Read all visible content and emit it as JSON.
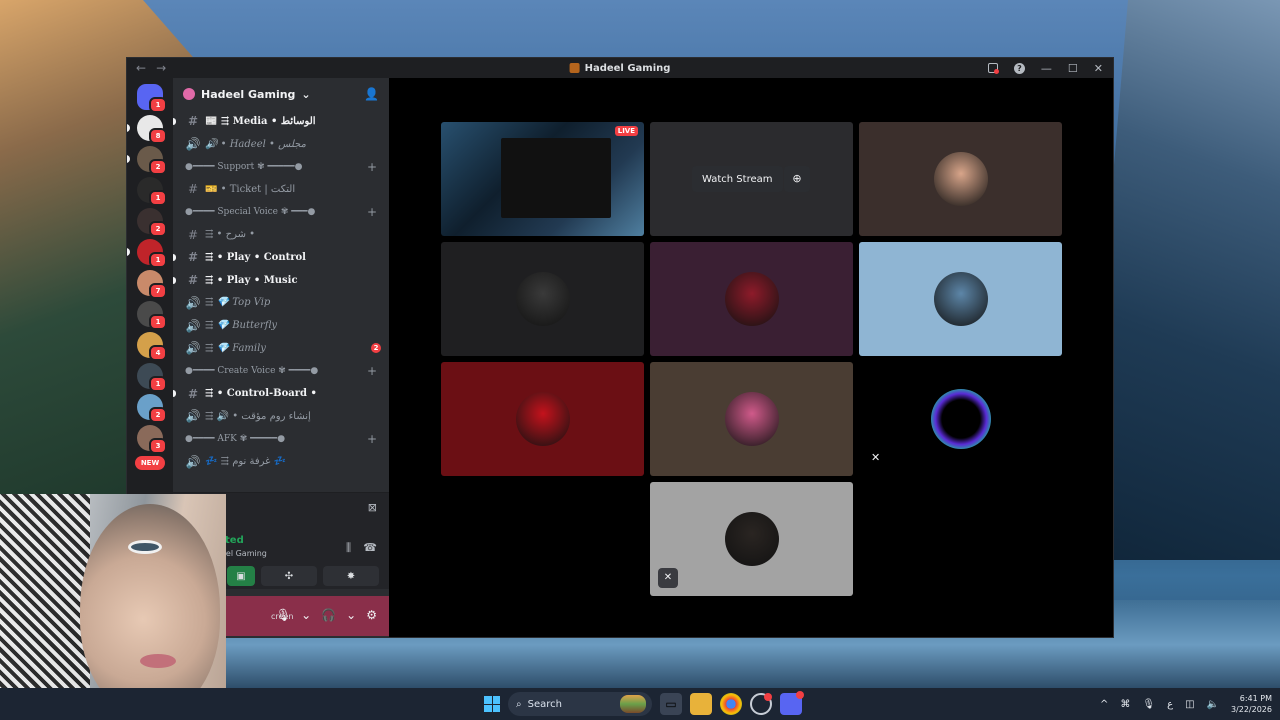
{
  "window": {
    "title": "Hadeel Gaming",
    "nav_back": "←",
    "nav_forward": "→",
    "help": "?",
    "minimize": "—",
    "maximize": "☐",
    "close": "✕"
  },
  "rail": {
    "servers": [
      {
        "badge": "1",
        "color": "#5865f2"
      },
      {
        "badge": "8",
        "color": "#e8e8e8"
      },
      {
        "badge": "2",
        "color": "#6a5a4a"
      },
      {
        "badge": "1",
        "color": "#2a2a2a"
      },
      {
        "badge": "2",
        "color": "#3a3030"
      },
      {
        "badge": "1",
        "color": "#c0242a"
      },
      {
        "badge": "7",
        "color": "#c98a6a"
      },
      {
        "badge": "1",
        "color": "#4a4a4a"
      },
      {
        "badge": "4",
        "color": "#d4a04a"
      },
      {
        "badge": "1",
        "color": "#3d4a55"
      },
      {
        "badge": "2",
        "color": "#6aa0c9"
      },
      {
        "badge": "3",
        "color": "#8a6a5a"
      }
    ],
    "new_label": "NEW"
  },
  "guild": {
    "name": "Hadeel Gaming",
    "chevron": "⌄"
  },
  "channels": [
    {
      "kind": "text",
      "icon": "#",
      "name": "📰 ⇶ Media • الوسائط",
      "bold": true,
      "italic": false
    },
    {
      "kind": "voice",
      "icon": "🔊",
      "name": "🔊 • Hadeel • مجلس",
      "bold": false,
      "italic": true
    },
    {
      "kind": "category",
      "name": "●━━━━ Support ✾ ━━━━━●"
    },
    {
      "kind": "text",
      "icon": "#",
      "name": "🎫 • Ticket | التكت",
      "bold": false,
      "italic": false
    },
    {
      "kind": "category",
      "name": "●━━━━ Special Voice ✾ ━━━●"
    },
    {
      "kind": "text",
      "icon": "#",
      "name": "⇶ • شرح •",
      "bold": false,
      "italic": false
    },
    {
      "kind": "text",
      "icon": "#",
      "name": "⇶ • Play • Control",
      "bold": true,
      "italic": false
    },
    {
      "kind": "text",
      "icon": "#",
      "name": "⇶ • Play • Music",
      "bold": true,
      "italic": false
    },
    {
      "kind": "voice",
      "icon": "🔊",
      "name": "⇶ 💎 Top Vip",
      "bold": false,
      "italic": true
    },
    {
      "kind": "voice",
      "icon": "🔊",
      "name": "⇶ 💎 Butterfly",
      "bold": false,
      "italic": true
    },
    {
      "kind": "voice",
      "icon": "🔊",
      "name": "⇶ 💎 Family",
      "bold": false,
      "italic": true,
      "count": "2"
    },
    {
      "kind": "category",
      "name": "●━━━━ Create Voice ✾ ━━━━●"
    },
    {
      "kind": "text",
      "icon": "#",
      "name": "⇶ • Control-Board •",
      "bold": true,
      "italic": false
    },
    {
      "kind": "voice",
      "icon": "🔊",
      "name": "⇶ 🔊 • إنشاء روم مؤقت",
      "bold": false,
      "italic": false
    },
    {
      "kind": "category",
      "name": "●━━━━ AFK ✾ ━━━━━●"
    },
    {
      "kind": "voice",
      "icon": "🔊",
      "name": "💤 ⇶ غرفة نوم 💤",
      "bold": false,
      "italic": false
    }
  ],
  "voice_panel": {
    "status": "ted",
    "server": "eel Gaming"
  },
  "user_panel": {
    "screen_label": "creen"
  },
  "stage": {
    "live_label": "LIVE",
    "watch_stream": "Watch Stream",
    "tiles": [
      {
        "bg": "#1d3146",
        "type": "stream"
      },
      {
        "bg": "#2b2b2e",
        "type": "watch"
      },
      {
        "bg": "#3b2f2c",
        "avatar": "#d8a58a"
      },
      {
        "bg": "#1f1f21",
        "avatar": "#3a3a3a"
      },
      {
        "bg": "#3a1f33",
        "avatar": "#8e1b2a"
      },
      {
        "bg": "#8fb5d3",
        "avatar": "#5d86a8"
      },
      {
        "bg": "#6b0f14",
        "avatar": "#c4121c"
      },
      {
        "bg": "#4a3d33",
        "avatar": "#d05a8a"
      },
      {
        "bg": "#000000",
        "avatar": "#111116",
        "muted": true
      },
      {
        "bg": "#a3a3a3",
        "avatar": "#2a2522",
        "muted_box": true
      }
    ]
  },
  "taskbar": {
    "search": "Search",
    "lang": "ع",
    "time": "6:41 PM",
    "date": "3/22/2026"
  }
}
